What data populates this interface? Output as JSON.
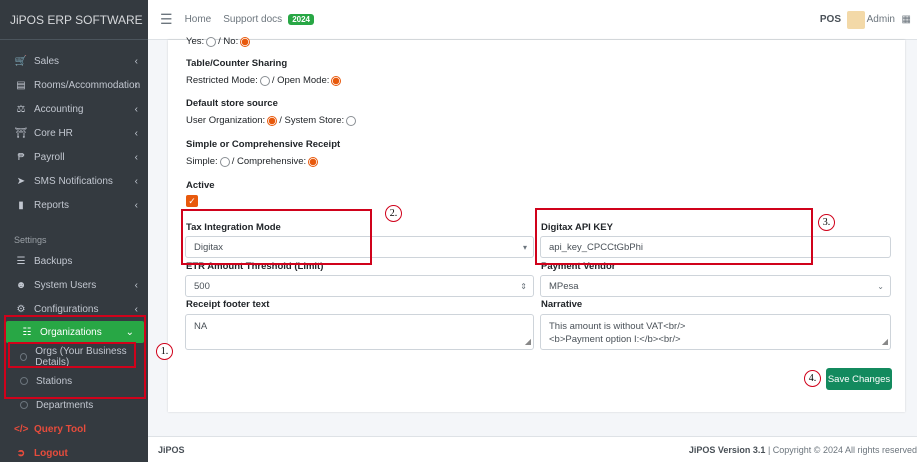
{
  "brand": "JiPOS ERP SOFTWARE",
  "sidebar": {
    "items": [
      {
        "label": "Sales",
        "icon": "cart-icon"
      },
      {
        "label": "Rooms/Accommodation",
        "icon": "bed-icon"
      },
      {
        "label": "Accounting",
        "icon": "scale-icon"
      },
      {
        "label": "Core HR",
        "icon": "bank-icon"
      },
      {
        "label": "Payroll",
        "icon": "peso-icon"
      },
      {
        "label": "SMS Notifications",
        "icon": "paper-plane-icon"
      },
      {
        "label": "Reports",
        "icon": "file-icon"
      }
    ],
    "settings_header": "Settings",
    "settings_items": [
      {
        "label": "Backups",
        "icon": "database-icon"
      },
      {
        "label": "System Users",
        "icon": "users-icon"
      },
      {
        "label": "Configurations",
        "icon": "gear-icon"
      },
      {
        "label": "Organizations",
        "icon": "sitemap-icon"
      }
    ],
    "sub_items": [
      "Orgs (Your Business Details)",
      "Stations",
      "Departments"
    ],
    "query_tool": "Query Tool",
    "logout": "Logout"
  },
  "topbar": {
    "home": "Home",
    "support": "Support docs",
    "badge": "2024",
    "pos": "POS",
    "user": "Admin"
  },
  "form": {
    "yes_no": {
      "yes": "Yes:",
      "no": "/ No:"
    },
    "table_sharing": {
      "label": "Table/Counter Sharing",
      "opt1": "Restricted Mode:",
      "opt2": "/ Open Mode:"
    },
    "store_source": {
      "label": "Default store source",
      "opt1": "User Organization:",
      "opt2": "/ System Store:"
    },
    "receipt": {
      "label": "Simple or Comprehensive Receipt",
      "opt1": "Simple:",
      "opt2": "/ Comprehensive:"
    },
    "active": {
      "label": "Active"
    },
    "tax_mode": {
      "label": "Tax Integration Mode",
      "value": "Digitax"
    },
    "api_key": {
      "label": "Digitax API KEY",
      "value": "api_key_CPCCtGbPhi"
    },
    "etr_threshold": {
      "label": "ETR Amount Threshold (Limit)",
      "value": "500"
    },
    "payment_vendor": {
      "label": "Payment Vendor",
      "value": "MPesa"
    },
    "footer_text": {
      "label": "Receipt footer text",
      "value": "NA"
    },
    "narrative": {
      "label": "Narrative",
      "line1": "This amount is without VAT<br/>",
      "line2": "<b>Payment option I:</b><br/>"
    },
    "save": "Save Changes"
  },
  "annotations": [
    "1.",
    "2.",
    "3.",
    "4."
  ],
  "footer": {
    "left": "JiPOS",
    "right_brand": "JiPOS Version 3.1",
    "right_rest": "| Copyright © 2024 All rights reserved"
  },
  "colors": {
    "accent": "#28a745",
    "save": "#138a5e",
    "radio": "#e8590c",
    "annotation": "#d0021b"
  }
}
